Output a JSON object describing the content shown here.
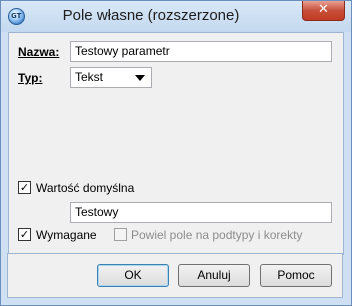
{
  "window": {
    "title": "Pole własne (rozszerzone)",
    "icon": "app-logo-icon",
    "icon_text": "GT",
    "close_glyph": "✕"
  },
  "form": {
    "name_label": "Nazwa:",
    "name_value": "Testowy parametr",
    "type_label": "Typ:",
    "type_value": "Tekst",
    "default_value_checkbox": {
      "label": "Wartość domyślna",
      "checked": true,
      "check_glyph": "✓"
    },
    "default_value": "Testowy",
    "required_checkbox": {
      "label": "Wymagane",
      "checked": true,
      "check_glyph": "✓"
    },
    "repeat_checkbox": {
      "label": "Powiel pole na podtypy i korekty",
      "checked": false,
      "disabled": true
    }
  },
  "buttons": {
    "ok": "OK",
    "cancel": "Anuluj",
    "help": "Pomoc"
  },
  "colors": {
    "frame": "#cfe0f3",
    "client_bg": "#f0f0f0",
    "close_button": "#c7503a"
  }
}
